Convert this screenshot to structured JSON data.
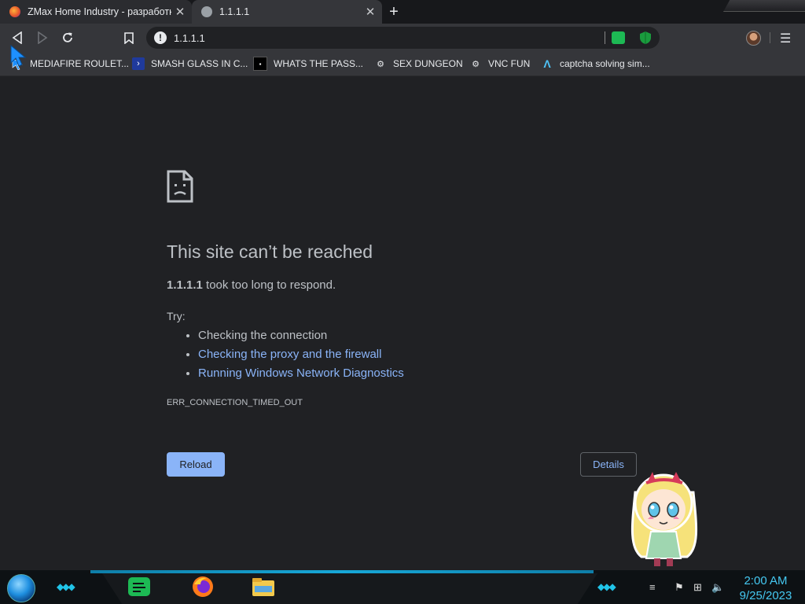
{
  "tabs": [
    {
      "title": "ZMax Home Industry - разработк",
      "active": false,
      "favicon": "firefox-like-icon"
    },
    {
      "title": "1.1.1.1",
      "active": true,
      "favicon": "globe-icon"
    }
  ],
  "toolbar": {
    "url": "1.1.1.1"
  },
  "bookmarks": [
    {
      "label": "MEDIAFIRE ROULET...",
      "icon": "cursor-icon"
    },
    {
      "label": "SMASH GLASS IN C...",
      "icon": "powershell-icon"
    },
    {
      "label": "WHATS THE PASS...",
      "icon": "terminal-icon"
    },
    {
      "label": "SEX DUNGEON",
      "icon": "vnc-icon"
    },
    {
      "label": "VNC FUN",
      "icon": "vnc-icon"
    },
    {
      "label": "captcha solving sim...",
      "icon": "lambda-icon"
    }
  ],
  "error": {
    "title": "This site can’t be reached",
    "host": "1.1.1.1",
    "message": "took too long to respond.",
    "try_label": "Try:",
    "suggestions": [
      "Checking the connection",
      "Checking the proxy and the firewall",
      "Running Windows Network Diagnostics"
    ],
    "code": "ERR_CONNECTION_TIMED_OUT",
    "reload_label": "Reload",
    "details_label": "Details"
  },
  "taskbar": {
    "time": "2:00 AM",
    "date": "9/25/2023"
  },
  "colors": {
    "page_bg": "#202124",
    "link": "#8ab4f8",
    "clock": "#45c9f2"
  }
}
